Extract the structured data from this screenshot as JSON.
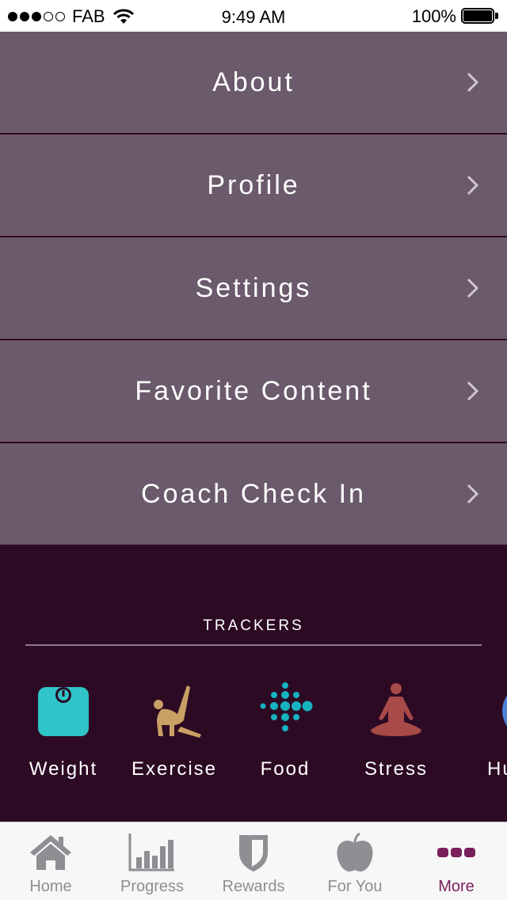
{
  "status_bar": {
    "carrier": "FAB",
    "time": "9:49 AM",
    "battery": "100%"
  },
  "menu": [
    {
      "label": "About"
    },
    {
      "label": "Profile"
    },
    {
      "label": "Settings"
    },
    {
      "label": "Favorite Content"
    },
    {
      "label": "Coach Check In"
    }
  ],
  "trackers": {
    "title": "TRACKERS",
    "items": [
      {
        "label": "Weight",
        "icon": "scale-icon",
        "color": "#2ec4c8"
      },
      {
        "label": "Exercise",
        "icon": "exercise-pose-icon",
        "color": "#c9a064"
      },
      {
        "label": "Food",
        "icon": "dots-icon",
        "color": "#16b2c0"
      },
      {
        "label": "Stress",
        "icon": "meditation-icon",
        "color": "#a84a48"
      },
      {
        "label": "Hun",
        "icon": "plate-fork-icon",
        "color": "#4c7fd6"
      }
    ]
  },
  "tabbar": {
    "items": [
      {
        "label": "Home",
        "icon": "home-icon"
      },
      {
        "label": "Progress",
        "icon": "bar-chart-icon"
      },
      {
        "label": "Rewards",
        "icon": "shield-icon"
      },
      {
        "label": "For You",
        "icon": "apple-icon"
      },
      {
        "label": "More",
        "icon": "more-dots-icon"
      }
    ],
    "active": "More",
    "active_color": "#7a1f5c",
    "inactive_color": "#8e8e93"
  }
}
